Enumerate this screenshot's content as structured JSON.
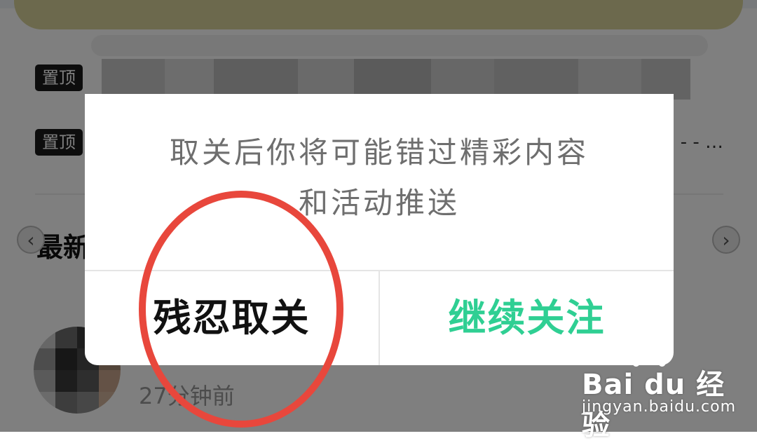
{
  "background": {
    "pinned_items": [
      {
        "badge": "置顶",
        "tail": ""
      },
      {
        "badge": "置顶",
        "tail": "- - …"
      }
    ],
    "section_title": "最新",
    "post_time": "27分钟前",
    "nav_left": "‹",
    "nav_right": "›"
  },
  "dialog": {
    "message_line1": "取关后你将可能错过精彩内容",
    "message_line2": "和活动推送",
    "cancel_button": "残忍取关",
    "keep_button": "继续关注"
  },
  "watermark": {
    "brand": "Bai du 经验",
    "url": "jingyan.baidu.com"
  },
  "colors": {
    "accent_green": "#2fcf93",
    "annotation_red": "#e8473c",
    "badge_black": "#1a1a1a"
  },
  "icons": {
    "nav_left": "chevron-left-icon",
    "nav_right": "chevron-right-icon",
    "paw": "paw-icon"
  }
}
